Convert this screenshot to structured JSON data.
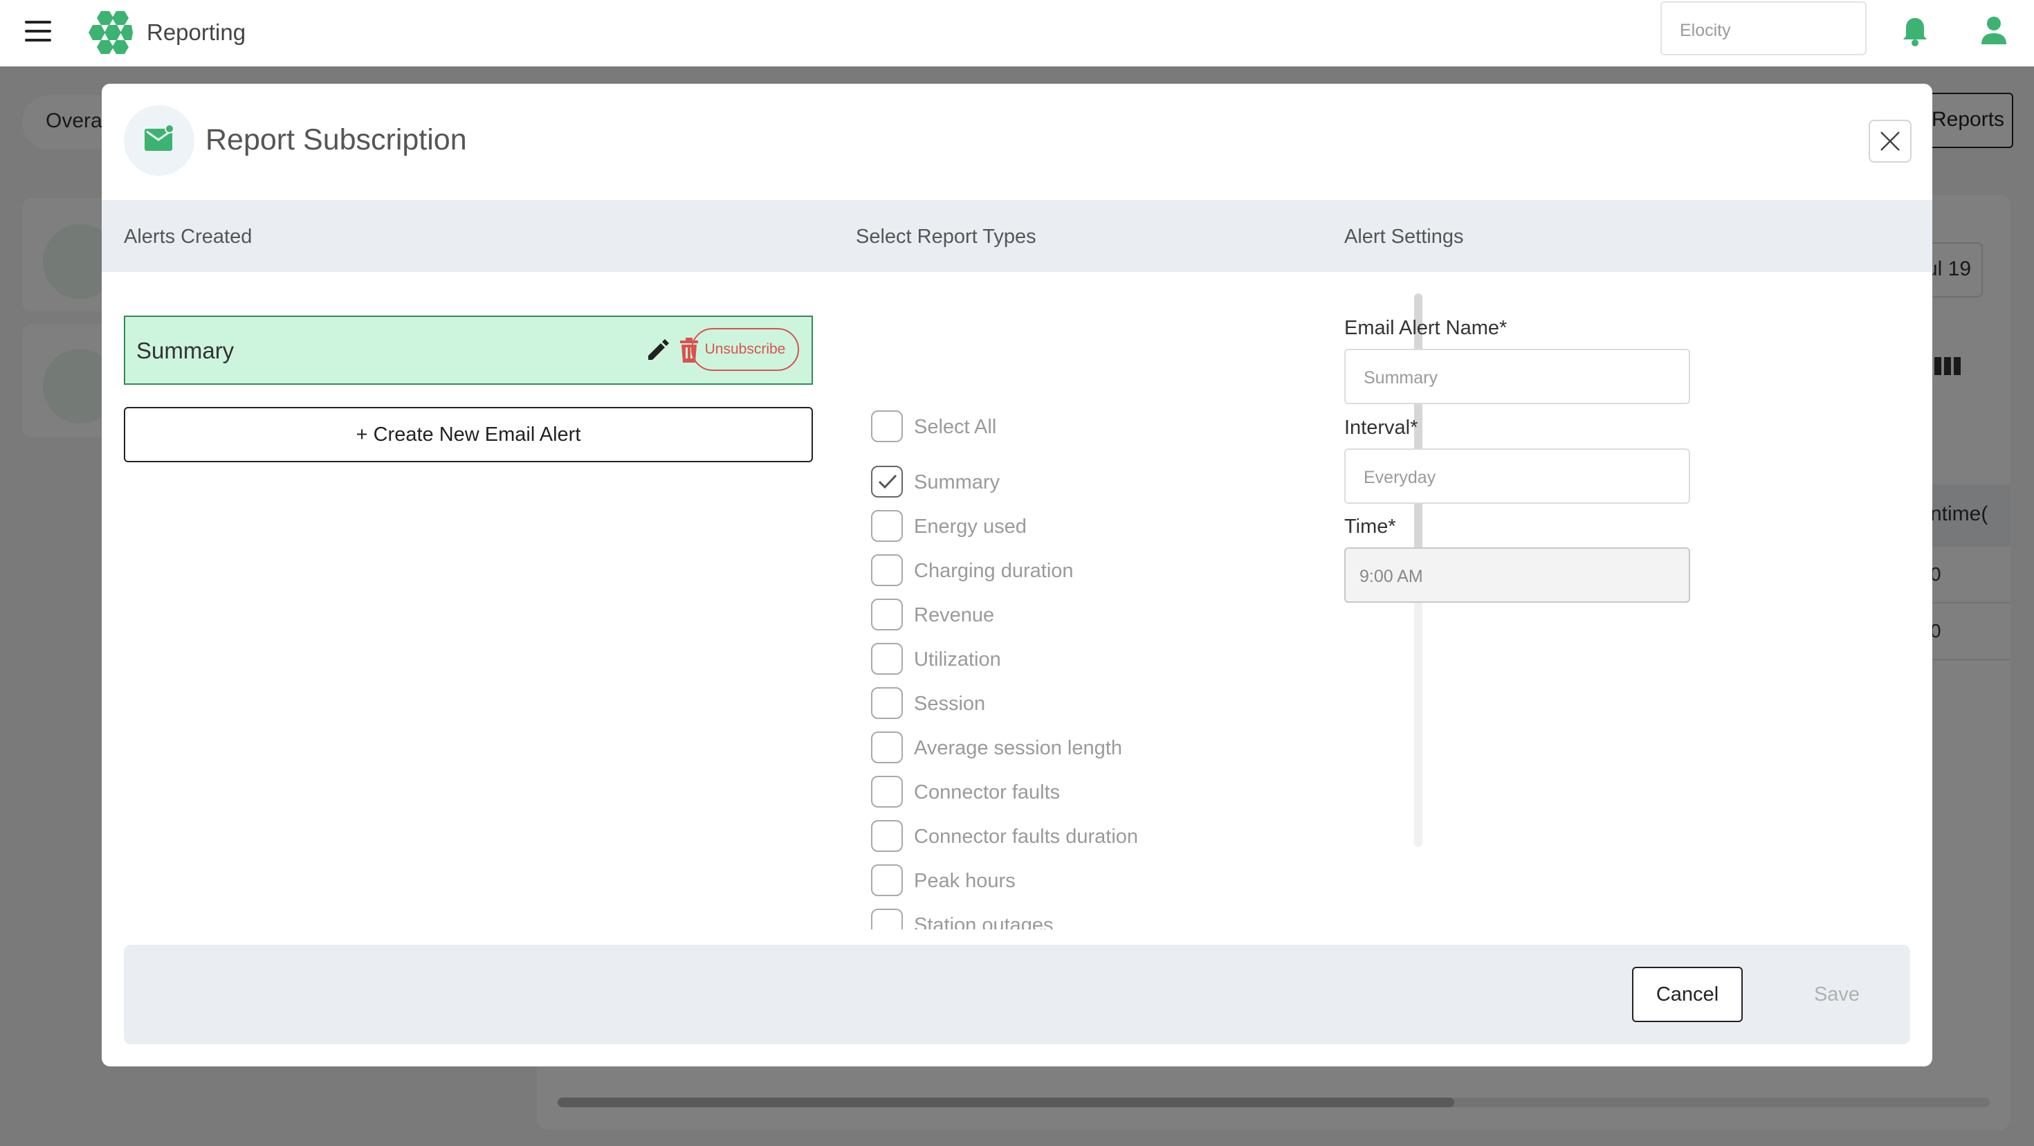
{
  "app": {
    "title": "Reporting",
    "tenant_select": "Elocity",
    "brand_color": "#3cb371"
  },
  "background": {
    "tab_pill": "Overa",
    "reports_button": "Reports",
    "date_chip": "ul 19",
    "table_header": "ntime(",
    "table_cells": [
      "0",
      "0"
    ]
  },
  "modal": {
    "title": "Report Subscription",
    "columns": {
      "alerts_created": "Alerts Created",
      "select_report_types": "Select Report Types",
      "alert_settings": "Alert Settings"
    },
    "alerts": [
      {
        "name": "Summary",
        "unsubscribe_label": "Unsubscribe"
      }
    ],
    "create_button": "+ Create New Email Alert",
    "report_types": [
      {
        "label": "Select All",
        "checked": false
      },
      {
        "label": "Summary",
        "checked": true
      },
      {
        "label": "Energy used",
        "checked": false
      },
      {
        "label": "Charging duration",
        "checked": false
      },
      {
        "label": "Revenue",
        "checked": false
      },
      {
        "label": "Utilization",
        "checked": false
      },
      {
        "label": "Session",
        "checked": false
      },
      {
        "label": "Average session length",
        "checked": false
      },
      {
        "label": "Connector faults",
        "checked": false
      },
      {
        "label": "Connector faults duration",
        "checked": false
      },
      {
        "label": "Peak hours",
        "checked": false
      },
      {
        "label": "Station outages",
        "checked": false
      }
    ],
    "settings": {
      "email_alert_name_label": "Email Alert Name*",
      "email_alert_name_placeholder": "Summary",
      "interval_label": "Interval*",
      "interval_placeholder": "Everyday",
      "time_label": "Time*",
      "time_value": "9:00 AM"
    },
    "footer": {
      "cancel": "Cancel",
      "save": "Save"
    }
  }
}
